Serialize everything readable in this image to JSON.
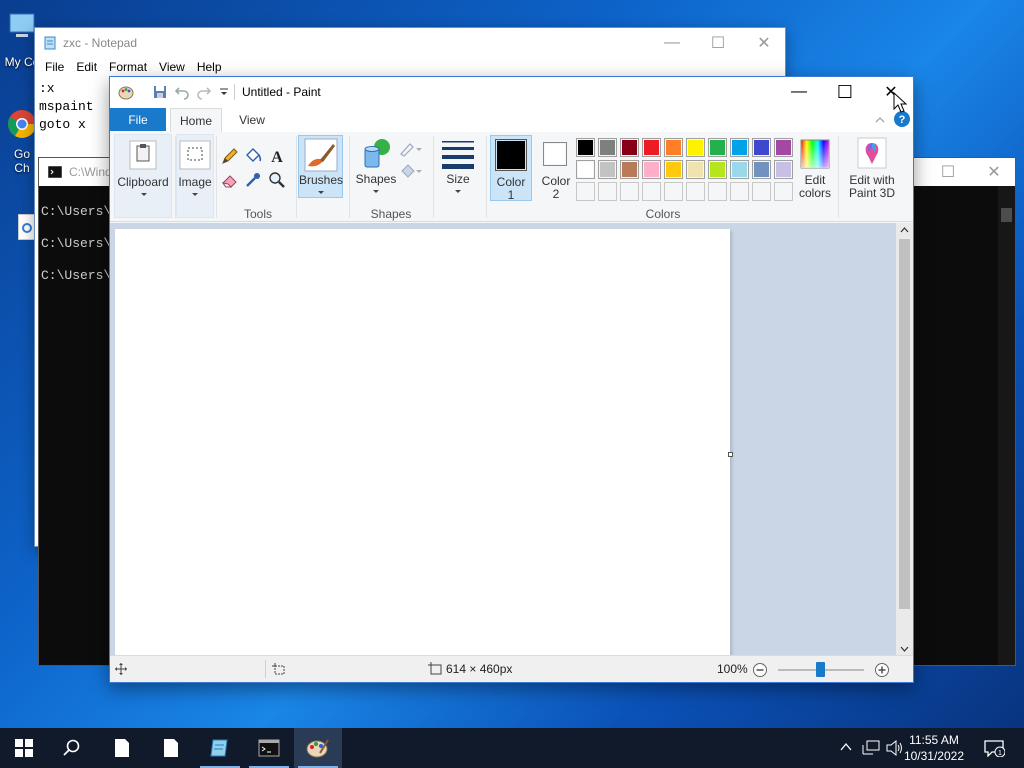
{
  "desktop": {
    "icons": [
      {
        "label": "My Co"
      },
      {
        "label": "Go"
      },
      {
        "label": "Ch"
      }
    ]
  },
  "notepad": {
    "title": "zxc - Notepad",
    "menu": [
      "File",
      "Edit",
      "Format",
      "View",
      "Help"
    ],
    "lines": [
      ":x",
      "mspaint",
      "goto x"
    ]
  },
  "cmd": {
    "title": "C:\\Wind",
    "lines": [
      "C:\\Users\\",
      "C:\\Users\\",
      "C:\\Users\\"
    ]
  },
  "paint": {
    "title": "Untitled - Paint",
    "tabs": {
      "file": "File",
      "home": "Home",
      "view": "View"
    },
    "groups": {
      "clipboard": "Clipboard",
      "image": "Image",
      "tools": "Tools",
      "brushes": "Brushes",
      "shapes_btn": "Shapes",
      "shapes": "Shapes",
      "size": "Size",
      "color1": "Color\n1",
      "color2": "Color\n2",
      "colors": "Colors",
      "edit_colors": "Edit\ncolors",
      "paint3d": "Edit with\nPaint 3D"
    },
    "palette_row1": [
      "#000000",
      "#7f7f7f",
      "#880015",
      "#ed1c24",
      "#ff7f27",
      "#fff200",
      "#22b14c",
      "#00a2e8",
      "#3f48cc",
      "#a349a4"
    ],
    "palette_row2": [
      "#ffffff",
      "#c3c3c3",
      "#b97a57",
      "#ffaec9",
      "#ffc90e",
      "#efe4b0",
      "#b5e61d",
      "#99d9ea",
      "#7092be",
      "#c8bfe7"
    ],
    "color1": "#000000",
    "color2": "#ffffff",
    "status": {
      "dimensions": "614 × 460px",
      "zoom": "100%"
    }
  },
  "taskbar": {
    "time": "11:55 AM",
    "date": "10/31/2022"
  }
}
